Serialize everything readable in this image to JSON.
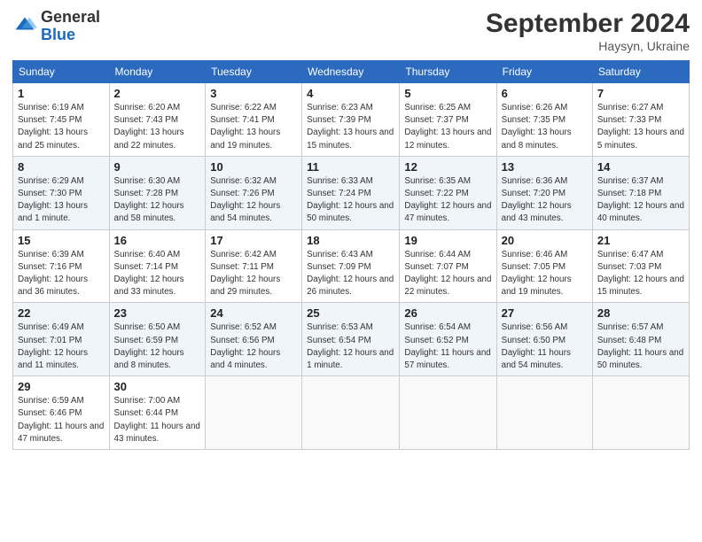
{
  "header": {
    "logo_general": "General",
    "logo_blue": "Blue",
    "month": "September 2024",
    "location": "Haysyn, Ukraine"
  },
  "columns": [
    "Sunday",
    "Monday",
    "Tuesday",
    "Wednesday",
    "Thursday",
    "Friday",
    "Saturday"
  ],
  "weeks": [
    [
      {
        "day": 1,
        "sunrise": "6:19 AM",
        "sunset": "7:45 PM",
        "daylight": "13 hours and 25 minutes."
      },
      {
        "day": 2,
        "sunrise": "6:20 AM",
        "sunset": "7:43 PM",
        "daylight": "13 hours and 22 minutes."
      },
      {
        "day": 3,
        "sunrise": "6:22 AM",
        "sunset": "7:41 PM",
        "daylight": "13 hours and 19 minutes."
      },
      {
        "day": 4,
        "sunrise": "6:23 AM",
        "sunset": "7:39 PM",
        "daylight": "13 hours and 15 minutes."
      },
      {
        "day": 5,
        "sunrise": "6:25 AM",
        "sunset": "7:37 PM",
        "daylight": "13 hours and 12 minutes."
      },
      {
        "day": 6,
        "sunrise": "6:26 AM",
        "sunset": "7:35 PM",
        "daylight": "13 hours and 8 minutes."
      },
      {
        "day": 7,
        "sunrise": "6:27 AM",
        "sunset": "7:33 PM",
        "daylight": "13 hours and 5 minutes."
      }
    ],
    [
      {
        "day": 8,
        "sunrise": "6:29 AM",
        "sunset": "7:30 PM",
        "daylight": "13 hours and 1 minute."
      },
      {
        "day": 9,
        "sunrise": "6:30 AM",
        "sunset": "7:28 PM",
        "daylight": "12 hours and 58 minutes."
      },
      {
        "day": 10,
        "sunrise": "6:32 AM",
        "sunset": "7:26 PM",
        "daylight": "12 hours and 54 minutes."
      },
      {
        "day": 11,
        "sunrise": "6:33 AM",
        "sunset": "7:24 PM",
        "daylight": "12 hours and 50 minutes."
      },
      {
        "day": 12,
        "sunrise": "6:35 AM",
        "sunset": "7:22 PM",
        "daylight": "12 hours and 47 minutes."
      },
      {
        "day": 13,
        "sunrise": "6:36 AM",
        "sunset": "7:20 PM",
        "daylight": "12 hours and 43 minutes."
      },
      {
        "day": 14,
        "sunrise": "6:37 AM",
        "sunset": "7:18 PM",
        "daylight": "12 hours and 40 minutes."
      }
    ],
    [
      {
        "day": 15,
        "sunrise": "6:39 AM",
        "sunset": "7:16 PM",
        "daylight": "12 hours and 36 minutes."
      },
      {
        "day": 16,
        "sunrise": "6:40 AM",
        "sunset": "7:14 PM",
        "daylight": "12 hours and 33 minutes."
      },
      {
        "day": 17,
        "sunrise": "6:42 AM",
        "sunset": "7:11 PM",
        "daylight": "12 hours and 29 minutes."
      },
      {
        "day": 18,
        "sunrise": "6:43 AM",
        "sunset": "7:09 PM",
        "daylight": "12 hours and 26 minutes."
      },
      {
        "day": 19,
        "sunrise": "6:44 AM",
        "sunset": "7:07 PM",
        "daylight": "12 hours and 22 minutes."
      },
      {
        "day": 20,
        "sunrise": "6:46 AM",
        "sunset": "7:05 PM",
        "daylight": "12 hours and 19 minutes."
      },
      {
        "day": 21,
        "sunrise": "6:47 AM",
        "sunset": "7:03 PM",
        "daylight": "12 hours and 15 minutes."
      }
    ],
    [
      {
        "day": 22,
        "sunrise": "6:49 AM",
        "sunset": "7:01 PM",
        "daylight": "12 hours and 11 minutes."
      },
      {
        "day": 23,
        "sunrise": "6:50 AM",
        "sunset": "6:59 PM",
        "daylight": "12 hours and 8 minutes."
      },
      {
        "day": 24,
        "sunrise": "6:52 AM",
        "sunset": "6:56 PM",
        "daylight": "12 hours and 4 minutes."
      },
      {
        "day": 25,
        "sunrise": "6:53 AM",
        "sunset": "6:54 PM",
        "daylight": "12 hours and 1 minute."
      },
      {
        "day": 26,
        "sunrise": "6:54 AM",
        "sunset": "6:52 PM",
        "daylight": "11 hours and 57 minutes."
      },
      {
        "day": 27,
        "sunrise": "6:56 AM",
        "sunset": "6:50 PM",
        "daylight": "11 hours and 54 minutes."
      },
      {
        "day": 28,
        "sunrise": "6:57 AM",
        "sunset": "6:48 PM",
        "daylight": "11 hours and 50 minutes."
      }
    ],
    [
      {
        "day": 29,
        "sunrise": "6:59 AM",
        "sunset": "6:46 PM",
        "daylight": "11 hours and 47 minutes."
      },
      {
        "day": 30,
        "sunrise": "7:00 AM",
        "sunset": "6:44 PM",
        "daylight": "11 hours and 43 minutes."
      },
      null,
      null,
      null,
      null,
      null
    ]
  ]
}
